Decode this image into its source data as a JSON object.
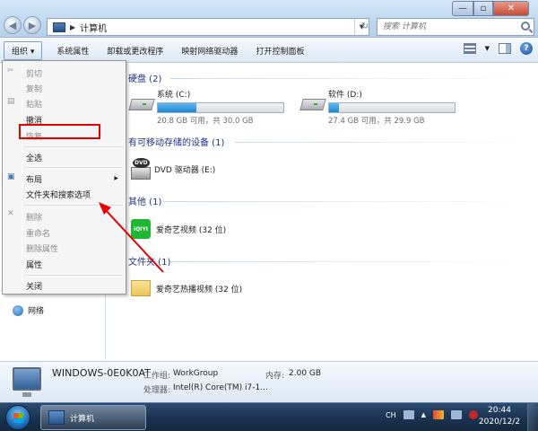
{
  "window": {
    "title_path": "计算机",
    "search_placeholder": "搜索 计算机",
    "controls": {
      "minimize": "—",
      "maximize": "▫",
      "close": "✕"
    }
  },
  "toolbar": {
    "organize": "组织 ▾",
    "items": [
      "系统属性",
      "卸载或更改程序",
      "映射网络驱动器",
      "打开控制面板"
    ]
  },
  "context_menu": {
    "cut": "剪切",
    "copy": "复制",
    "paste": "粘贴",
    "undo": "撤消",
    "redo": "恢复",
    "select_all": "全选",
    "layout": "布局",
    "folder_options": "文件夹和搜索选项",
    "delete": "删除",
    "rename": "重命名",
    "remove_properties": "删除属性",
    "properties": "属性",
    "close": "关闭"
  },
  "groups": {
    "hard_disks": "硬盘 (2)",
    "removable": "有可移动存储的设备 (1)",
    "other": "其他 (1)",
    "folders": "文件夹 (1)"
  },
  "drives": [
    {
      "name": "系统 (C:)",
      "size": "20.8 GB 可用，共 30.0 GB",
      "used_fraction": 0.31
    },
    {
      "name": "软件 (D:)",
      "size": "27.4 GB 可用，共 29.9 GB",
      "used_fraction": 0.08
    }
  ],
  "dvd": {
    "name": "DVD 驱动器 (E:)"
  },
  "other_item": {
    "name": "爱奇艺视频 (32 位)",
    "logo": "iQIYI"
  },
  "folder_item": {
    "name": "爱奇艺热播视频 (32 位)"
  },
  "nav": {
    "network": "网络"
  },
  "details": {
    "computer_name": "WINDOWS-0E0K0AT",
    "workgroup_key": "工作组:",
    "workgroup_val": "WorkGroup",
    "memory_key": "内存:",
    "memory_val": "2.00 GB",
    "cpu_key": "处理器:",
    "cpu_val": "Intel(R) Core(TM) i7-1..."
  },
  "taskbar": {
    "app_label": "计算机",
    "lang": "CH",
    "time": "20:44",
    "date": "2020/12/2"
  },
  "colors": {
    "annotation": "#e60000",
    "drive_bar": "#1e88d2",
    "iqiyi": "#1fb632"
  }
}
